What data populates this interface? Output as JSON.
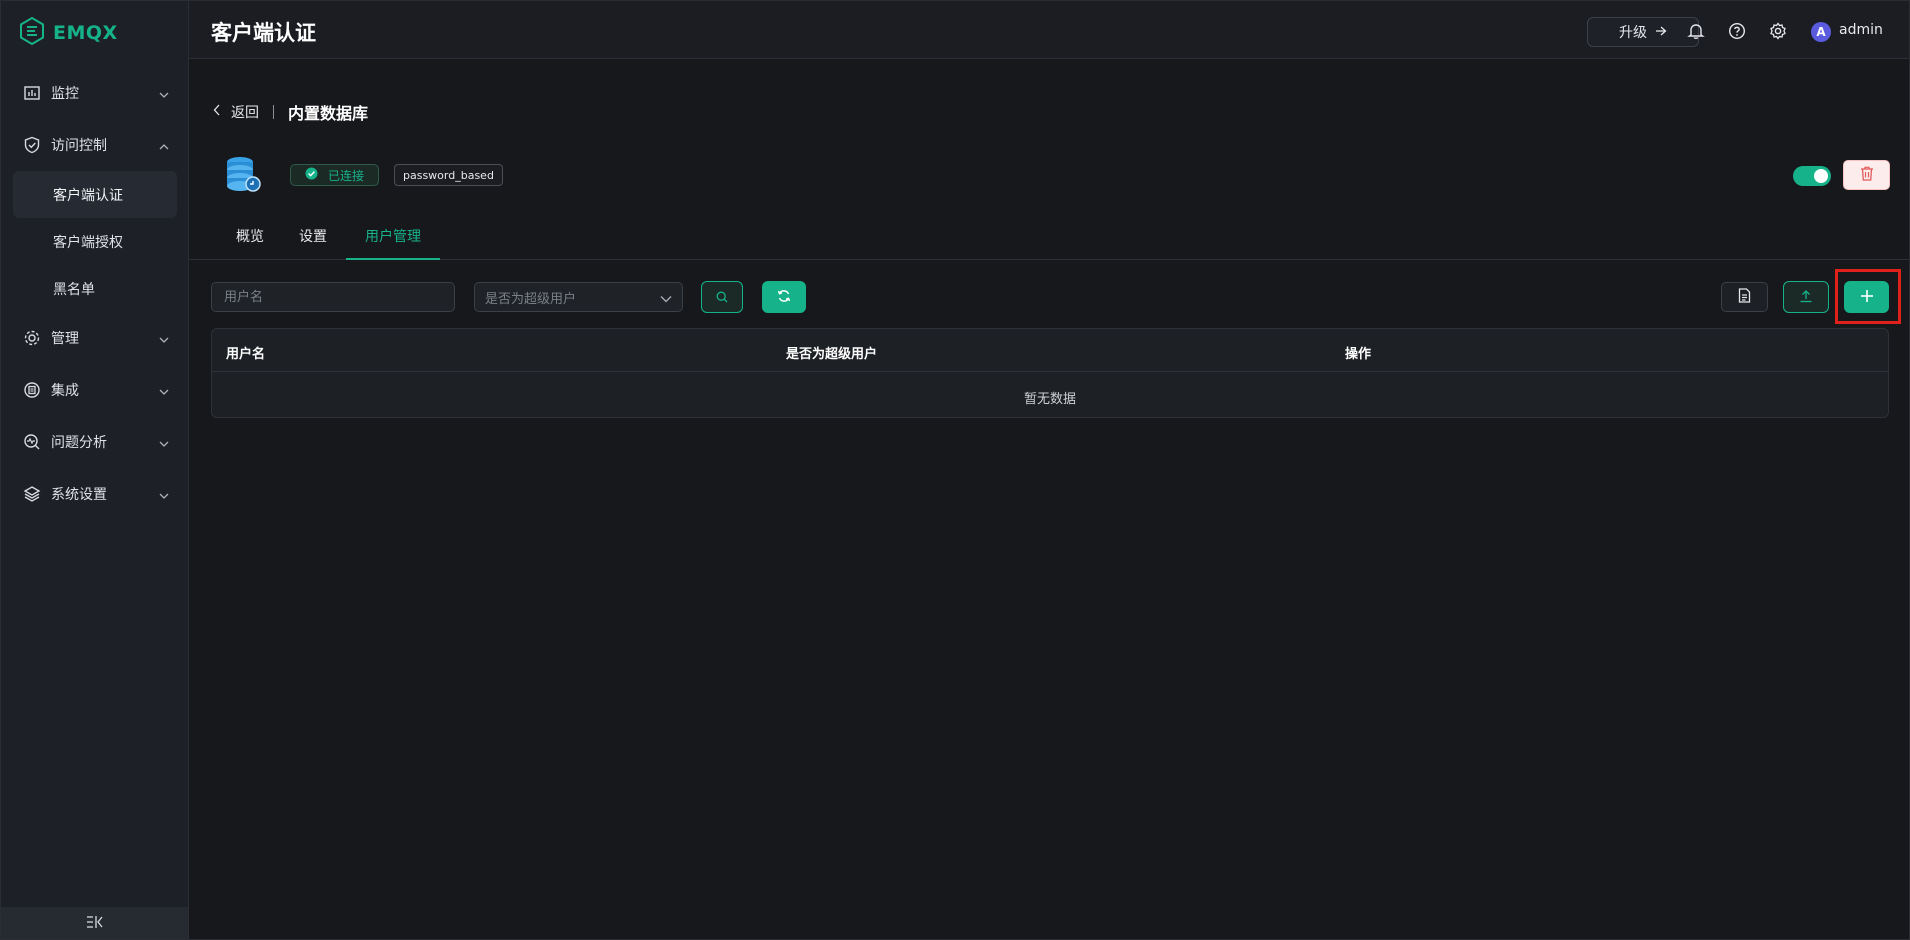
{
  "app": {
    "logo_text": "EMQX"
  },
  "sidebar": {
    "groups": [
      {
        "label": "监控",
        "icon": "chart-icon",
        "expanded": false
      },
      {
        "label": "访问控制",
        "icon": "shield-icon",
        "expanded": true,
        "items": [
          {
            "label": "客户端认证",
            "active": true
          },
          {
            "label": "客户端授权",
            "active": false
          },
          {
            "label": "黑名单",
            "active": false
          }
        ]
      },
      {
        "label": "管理",
        "icon": "gear-cog-icon",
        "expanded": false
      },
      {
        "label": "集成",
        "icon": "integration-icon",
        "expanded": false
      },
      {
        "label": "问题分析",
        "icon": "diagnose-icon",
        "expanded": false
      },
      {
        "label": "系统设置",
        "icon": "layers-icon",
        "expanded": false
      }
    ]
  },
  "header": {
    "title": "客户端认证",
    "upgrade_label": "升级",
    "user": {
      "avatar_letter": "A",
      "name": "admin"
    }
  },
  "main": {
    "breadcrumb": {
      "back_label": "返回",
      "title": "内置数据库"
    },
    "status_label": "已连接",
    "mechanism_tag": "password_based",
    "enabled": true,
    "tabs": [
      {
        "label": "概览",
        "active": false
      },
      {
        "label": "设置",
        "active": false
      },
      {
        "label": "用户管理",
        "active": true
      }
    ],
    "filters": {
      "username_placeholder": "用户名",
      "superuser_placeholder": "是否为超级用户"
    },
    "table": {
      "columns": [
        "用户名",
        "是否为超级用户",
        "操作"
      ],
      "empty_text": "暂无数据"
    }
  },
  "colors": {
    "accent": "#16b38a",
    "danger": "#e05a5a",
    "highlight": "#e0201a"
  }
}
